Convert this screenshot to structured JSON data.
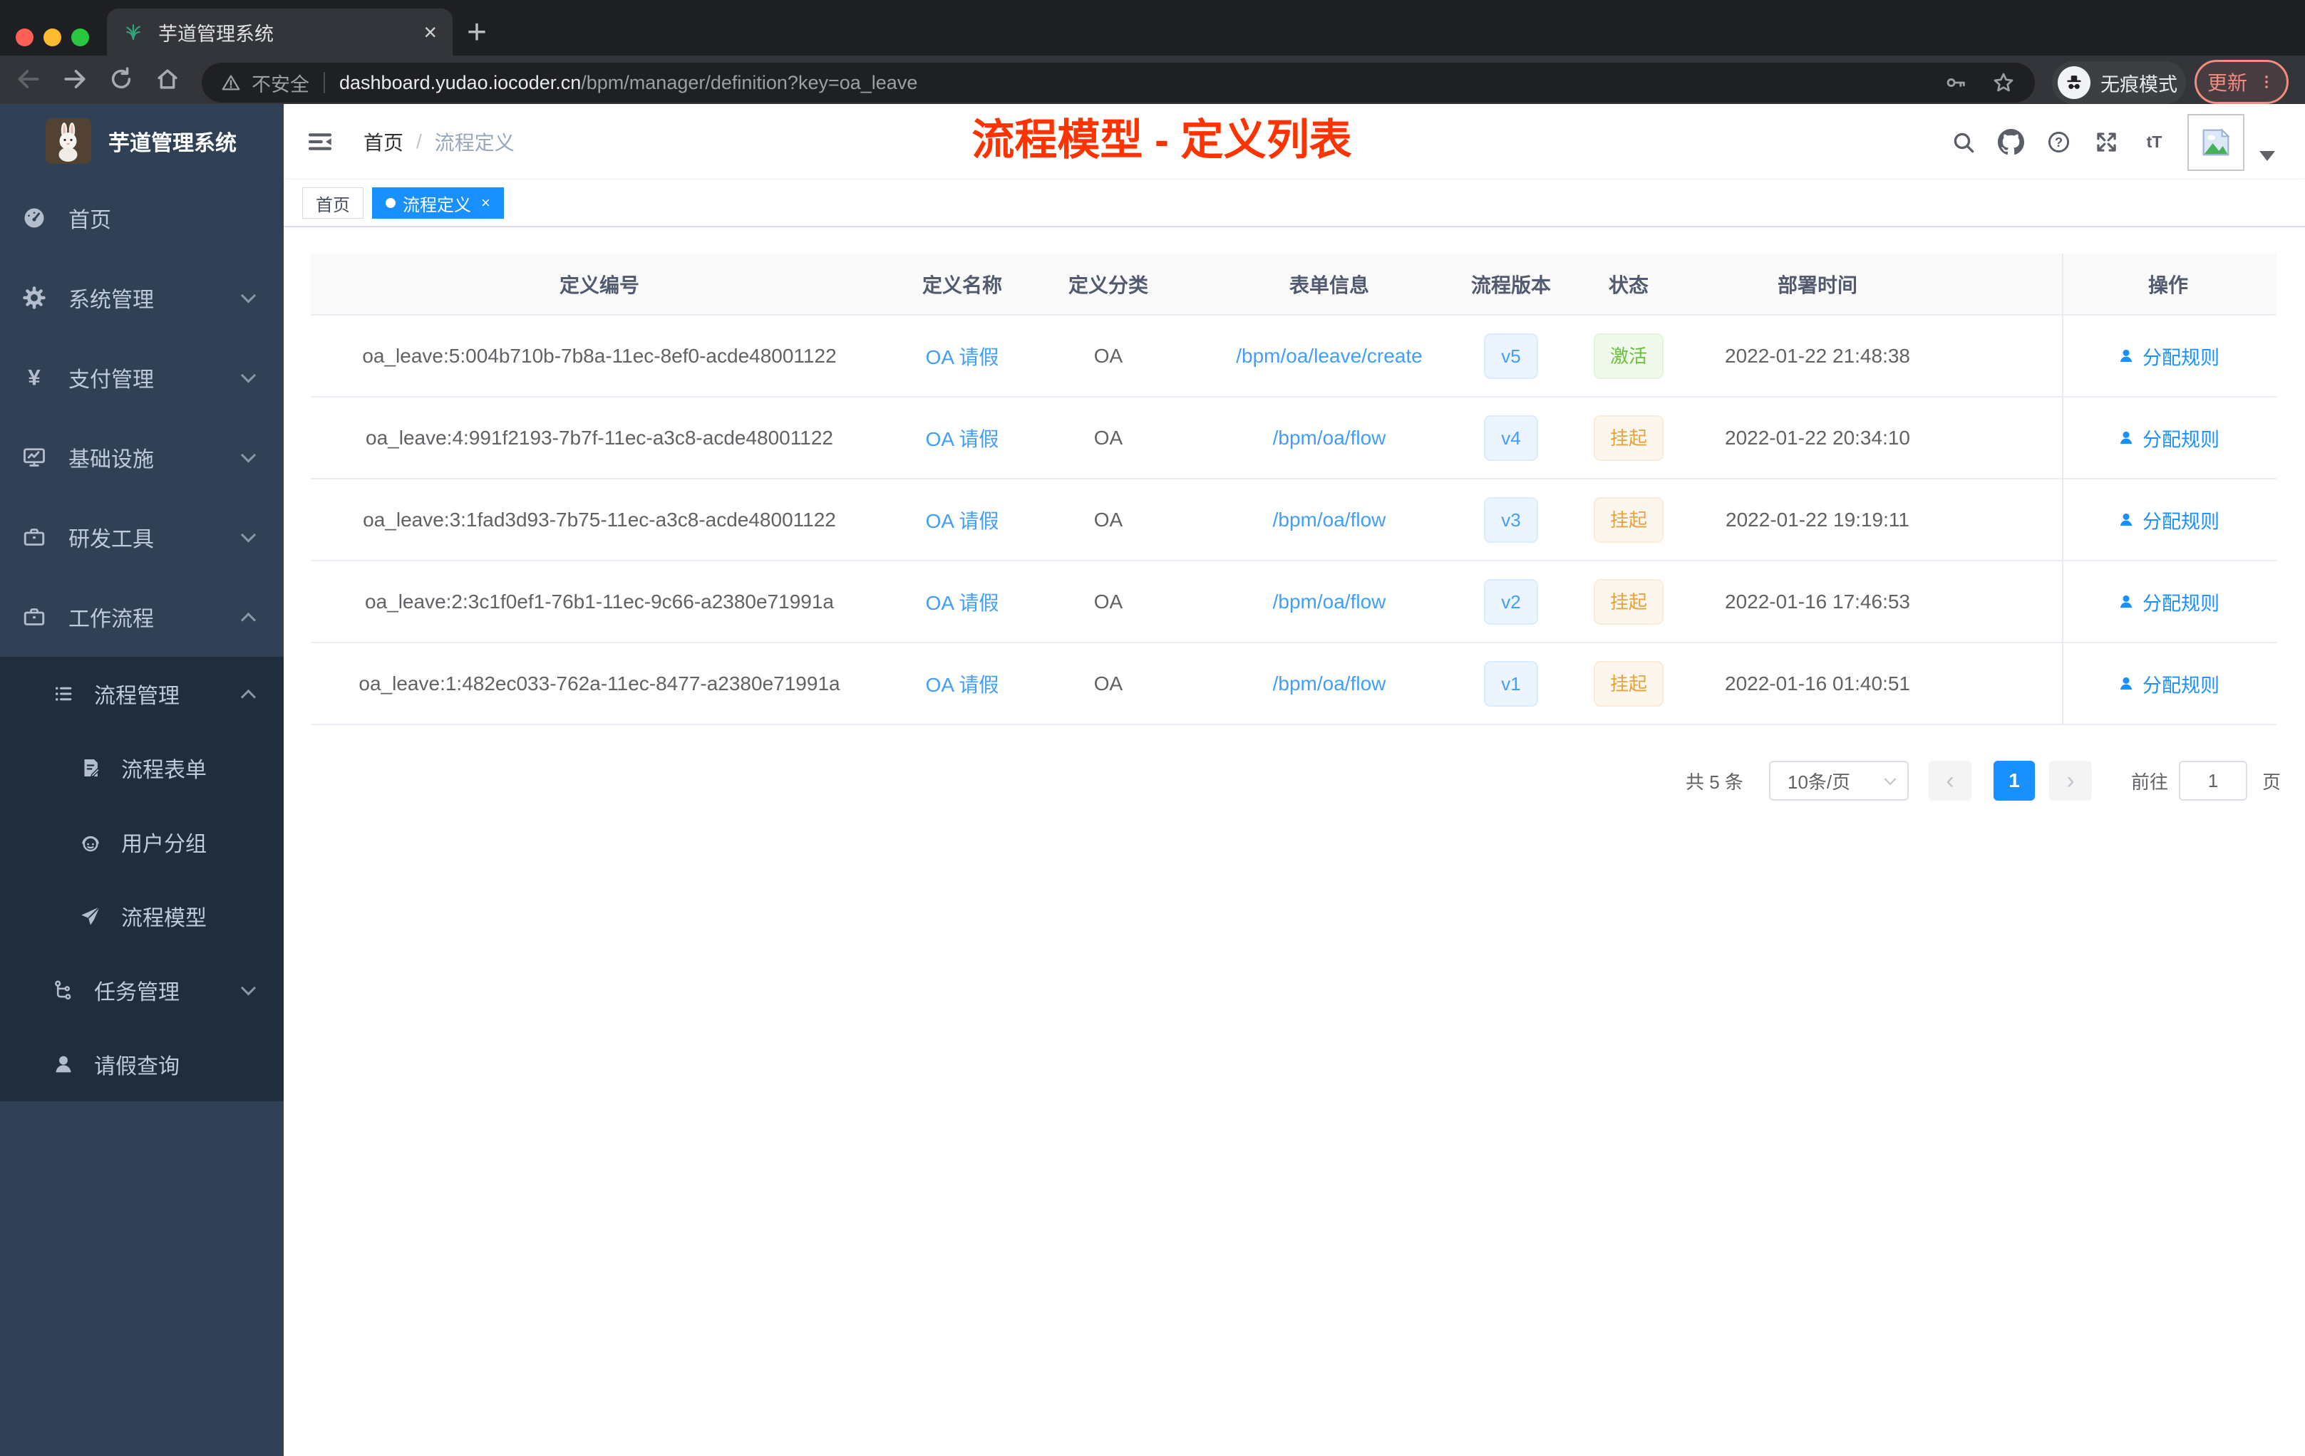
{
  "colors": {
    "accent": "#1890ff",
    "link": "#409eff",
    "success": "#67c23a",
    "warning": "#e6a23c",
    "annotation": "#ff3300",
    "update": "#f28b82",
    "sidebar_bg": "#304156",
    "sidebar_sub_bg": "#1f2d3d"
  },
  "browser": {
    "tab": {
      "favicon": "plant-icon",
      "title": "芋道管理系统",
      "close_glyph": "×",
      "new_tab_glyph": "+"
    },
    "toolbar": {
      "nav_icons": [
        {
          "icon": "back-icon"
        },
        {
          "icon": "forward-icon"
        },
        {
          "icon": "reload-icon"
        },
        {
          "icon": "home-icon"
        }
      ],
      "security_icon": "warning-icon",
      "security_label": "不安全",
      "url_domain": "dashboard.yudao.iocoder.cn",
      "url_path": "/bpm/manager/definition?key=oa_leave",
      "key_icon": "key-icon",
      "star_icon": "star-icon",
      "incognito_icon": "incognito-icon",
      "incognito_label": "无痕模式",
      "update_label": "更新",
      "menu_icon": "dots-vertical-icon"
    }
  },
  "sidebar": {
    "logo_icon": "bunny-avatar",
    "logo_title": "芋道管理系统",
    "items": [
      {
        "label": "首页",
        "icon": "dashboard-icon",
        "arrow": ""
      },
      {
        "label": "系统管理",
        "icon": "gear-icon",
        "arrow": "down"
      },
      {
        "label": "支付管理",
        "icon": "yen-icon",
        "arrow": "down"
      },
      {
        "label": "基础设施",
        "icon": "monitor-icon",
        "arrow": "down"
      },
      {
        "label": "研发工具",
        "icon": "toolbox-icon",
        "arrow": "down"
      },
      {
        "label": "工作流程",
        "icon": "briefcase-icon",
        "arrow": "up"
      }
    ],
    "submenu": [
      {
        "label": "流程管理",
        "icon": "list-icon",
        "arrow": "up",
        "lv": "lv2"
      },
      {
        "label": "流程表单",
        "icon": "form-icon",
        "arrow": "",
        "lv": "lv3"
      },
      {
        "label": "用户分组",
        "icon": "robot-icon",
        "arrow": "",
        "lv": "lv3"
      },
      {
        "label": "流程模型",
        "icon": "send-icon",
        "arrow": "",
        "lv": "lv3"
      },
      {
        "label": "任务管理",
        "icon": "tree-icon",
        "arrow": "down",
        "lv": "lv2"
      },
      {
        "label": "请假查询",
        "icon": "user-icon",
        "arrow": "",
        "lv": "lv2"
      }
    ]
  },
  "header": {
    "hamburger_icon": "hamburger-icon",
    "breadcrumb": {
      "home": "首页",
      "sep": "/",
      "current": "流程定义"
    },
    "icons": [
      {
        "icon": "search-icon"
      },
      {
        "icon": "github-icon"
      },
      {
        "icon": "question-icon"
      },
      {
        "icon": "fullscreen-icon"
      },
      {
        "icon": "fontsize-icon"
      }
    ],
    "avatar_icon": "image-placeholder-icon",
    "annotation": "流程模型 - 定义列表"
  },
  "tagsbar": {
    "close_glyph": "×",
    "tags": [
      {
        "label": "首页",
        "state": ""
      },
      {
        "label": "流程定义",
        "state": "active"
      }
    ]
  },
  "table": {
    "columns": [
      {
        "label": "定义编号",
        "cls": "c-id"
      },
      {
        "label": "定义名称",
        "cls": "c-name"
      },
      {
        "label": "定义分类",
        "cls": "c-cat"
      },
      {
        "label": "表单信息",
        "cls": "c-form"
      },
      {
        "label": "流程版本",
        "cls": "c-ver"
      },
      {
        "label": "状态",
        "cls": "c-status"
      },
      {
        "label": "部署时间",
        "cls": "c-time"
      },
      {
        "label": "操作",
        "cls": "c-action"
      }
    ],
    "rows": [
      {
        "id": "oa_leave:5:004b710b-7b8a-11ec-8ef0-acde48001122",
        "name": "OA 请假",
        "category": "OA",
        "form": "/bpm/oa/leave/create",
        "version": "v5",
        "status": "激活",
        "status_type": "success",
        "time": "2022-01-22 21:48:38",
        "action": "分配规则"
      },
      {
        "id": "oa_leave:4:991f2193-7b7f-11ec-a3c8-acde48001122",
        "name": "OA 请假",
        "category": "OA",
        "form": "/bpm/oa/flow",
        "version": "v4",
        "status": "挂起",
        "status_type": "warning",
        "time": "2022-01-22 20:34:10",
        "action": "分配规则"
      },
      {
        "id": "oa_leave:3:1fad3d93-7b75-11ec-a3c8-acde48001122",
        "name": "OA 请假",
        "category": "OA",
        "form": "/bpm/oa/flow",
        "version": "v3",
        "status": "挂起",
        "status_type": "warning",
        "time": "2022-01-22 19:19:11",
        "action": "分配规则"
      },
      {
        "id": "oa_leave:2:3c1f0ef1-76b1-11ec-9c66-a2380e71991a",
        "name": "OA 请假",
        "category": "OA",
        "form": "/bpm/oa/flow",
        "version": "v2",
        "status": "挂起",
        "status_type": "warning",
        "time": "2022-01-16 17:46:53",
        "action": "分配规则"
      },
      {
        "id": "oa_leave:1:482ec033-762a-11ec-8477-a2380e71991a",
        "name": "OA 请假",
        "category": "OA",
        "form": "/bpm/oa/flow",
        "version": "v1",
        "status": "挂起",
        "status_type": "warning",
        "time": "2022-01-16 01:40:51",
        "action": "分配规则"
      }
    ]
  },
  "pagination": {
    "total": "共 5 条",
    "page_size": "10条/页",
    "prev_glyph": "‹",
    "page": "1",
    "next_glyph": "›",
    "goto_label": "前往",
    "goto_value": "1",
    "page_unit": "页"
  }
}
